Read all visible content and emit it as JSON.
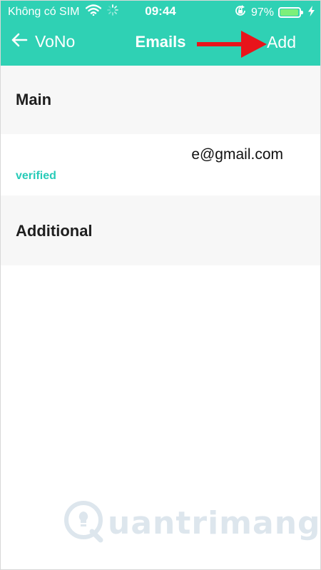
{
  "theme": {
    "accent_color": "#2fd1b4",
    "verified_color": "#27cbb8",
    "annotation_arrow_color": "#e8141b"
  },
  "status_bar": {
    "carrier": "Không có SIM",
    "time": "09:44",
    "battery_percent": "97%",
    "battery_level": 0.97,
    "icons": [
      "wifi-icon",
      "loading-spinner-icon",
      "orientation-lock-icon",
      "battery-icon",
      "charging-bolt-icon"
    ]
  },
  "nav": {
    "back_label": "VoNo",
    "back_icon": "arrow-left-icon",
    "title": "Emails",
    "add_label": "Add"
  },
  "sections": {
    "main_label": "Main",
    "additional_label": "Additional"
  },
  "emails": [
    {
      "address": "e@gmail.com",
      "status": "verified"
    }
  ],
  "watermark": {
    "text": "uantrimang",
    "icon": "quantrimang-logo-icon"
  }
}
